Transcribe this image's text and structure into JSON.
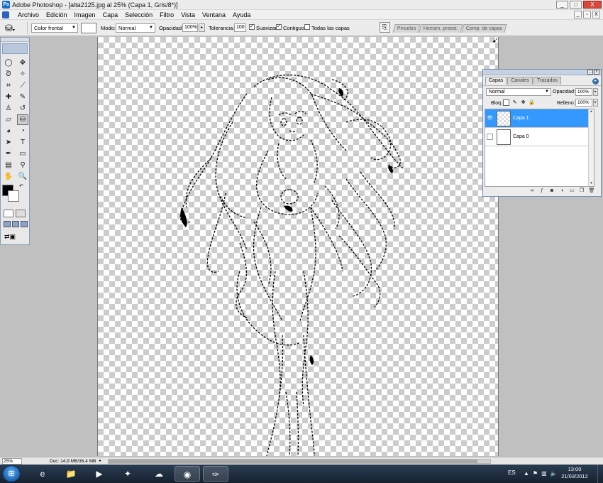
{
  "window": {
    "title": "Adobe Photoshop - [alta2125.jpg al 25% (Capa 1, Gris/8*)]",
    "app_icon": "Ps",
    "buttons": [
      "_",
      "□",
      "X"
    ]
  },
  "menu": {
    "items": [
      "Archivo",
      "Edición",
      "Imagen",
      "Capa",
      "Selección",
      "Filtro",
      "Vista",
      "Ventana",
      "Ayuda"
    ],
    "doc_buttons": [
      "_",
      "▫",
      "X"
    ]
  },
  "options": {
    "fill_source": "Color frontal",
    "mode_label": "Modo:",
    "mode_value": "Normal",
    "opacity_label": "Opacidad:",
    "opacity_value": "100%",
    "tolerance_label": "Tolerancia:",
    "tolerance_value": "100",
    "antialias_label": "Suavizar",
    "antialias_checked": true,
    "contiguous_label": "Contiguo",
    "contiguous_checked": true,
    "all_layers_label": "Todas las capas",
    "all_layers_checked": false
  },
  "palette_well": {
    "tabs": [
      "Pinceles",
      "Herram. preest.",
      "Comp. de capas"
    ]
  },
  "toolbox": {
    "tools": [
      {
        "icon": "marquee-icon",
        "glyph": "◯"
      },
      {
        "icon": "move-icon",
        "glyph": "✥"
      },
      {
        "icon": "lasso-icon",
        "glyph": "ᘐ"
      },
      {
        "icon": "magic-wand-icon",
        "glyph": "✧"
      },
      {
        "icon": "crop-icon",
        "glyph": "⌗"
      },
      {
        "icon": "slice-icon",
        "glyph": "⟋"
      },
      {
        "icon": "healing-brush-icon",
        "glyph": "✚"
      },
      {
        "icon": "brush-icon",
        "glyph": "✎"
      },
      {
        "icon": "clone-stamp-icon",
        "glyph": "♙"
      },
      {
        "icon": "history-brush-icon",
        "glyph": "↺"
      },
      {
        "icon": "eraser-icon",
        "glyph": "▱"
      },
      {
        "icon": "paint-bucket-icon",
        "glyph": "⛁"
      },
      {
        "icon": "blur-icon",
        "glyph": "◕"
      },
      {
        "icon": "dodge-icon",
        "glyph": "◔"
      },
      {
        "icon": "path-selection-icon",
        "glyph": "➤"
      },
      {
        "icon": "type-icon",
        "glyph": "T"
      },
      {
        "icon": "pen-icon",
        "glyph": "✒"
      },
      {
        "icon": "rectangle-icon",
        "glyph": "▭"
      },
      {
        "icon": "notes-icon",
        "glyph": "▤"
      },
      {
        "icon": "eyedropper-icon",
        "glyph": "⚲"
      },
      {
        "icon": "hand-icon",
        "glyph": "✋"
      },
      {
        "icon": "zoom-icon",
        "glyph": "🔍"
      }
    ],
    "foreground_color": "#000000",
    "background_color": "#ffffff"
  },
  "layers_panel": {
    "tabs": [
      "Capas",
      "Canales",
      "Trazados"
    ],
    "blend_mode": "Normal",
    "opacity_label": "Opacidad:",
    "opacity_value": "100%",
    "lock_label": "Bloq.:",
    "fill_label": "Relleno:",
    "fill_value": "100%",
    "layers": [
      {
        "name": "Capa 1",
        "visible": true,
        "selected": true
      },
      {
        "name": "Capa 0",
        "visible": false,
        "selected": false
      }
    ]
  },
  "status": {
    "zoom": "25%",
    "doc_info": "Doc: 14,9 MB/36,4 MB"
  },
  "taskbar": {
    "language": "ES",
    "time": "13:00",
    "date": "21/03/2012",
    "apps": [
      "internet-explorer-icon",
      "folder-icon",
      "media-player-icon",
      "app-icon",
      "app-icon",
      "chrome-icon",
      "photoshop-feather-icon"
    ]
  }
}
